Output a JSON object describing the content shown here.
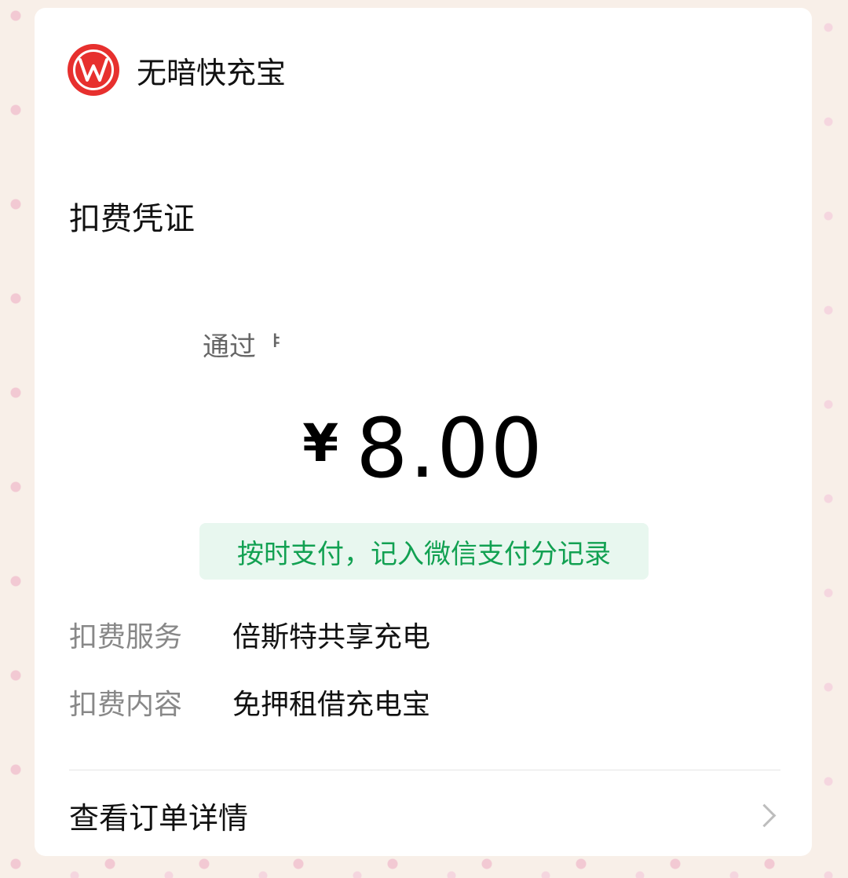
{
  "header": {
    "logo_icon": "brand-logo-w",
    "logo_color": "#e7302e",
    "app_name": "无暗快充宝"
  },
  "receipt": {
    "title": "扣费凭证",
    "via_text": "通过ᅣ",
    "currency": "¥",
    "amount": "8.00",
    "status_badge": "按时支付，记入微信支付分记录",
    "status_color": "#12a152"
  },
  "details": [
    {
      "label": "扣费服务",
      "value": "倍斯特共享充电"
    },
    {
      "label": "扣费内容",
      "value": "免押租借充电宝"
    }
  ],
  "footer": {
    "view_order_label": "查看订单详情",
    "chevron_icon": "chevron-right-icon"
  }
}
